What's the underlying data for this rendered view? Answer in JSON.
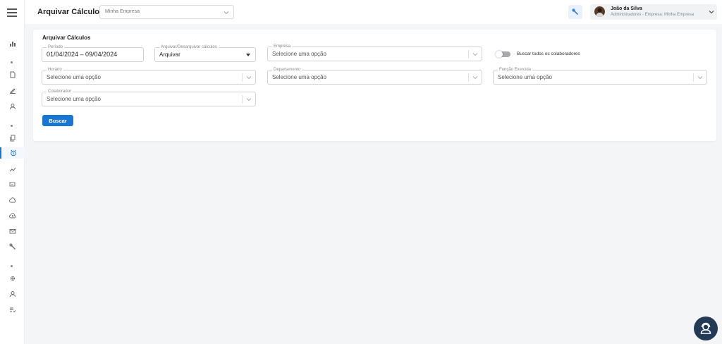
{
  "header": {
    "title": "Arquivar Cálculos",
    "company_select": "Minha Empresa",
    "user": {
      "name": "João da Silva",
      "role": "Administradores - Empresa: Minha Empresa"
    }
  },
  "sidebar": {
    "icons": [
      "chart-icon",
      "document-icon",
      "pen-icon",
      "user-icon",
      "copy-icon",
      "alarm-icon",
      "trend-icon",
      "chat-icon",
      "cloud-icon",
      "cloud-upload-icon",
      "mail-icon",
      "wrench-icon",
      "gear-icon",
      "person-icon",
      "checklist-icon"
    ],
    "active": "alarm-icon"
  },
  "form": {
    "title": "Arquivar Cálculos",
    "periodo": {
      "label": "Período",
      "value": "01/04/2024 – 09/04/2024"
    },
    "arquivar": {
      "label": "Arquivar/Desarquivar cálculos",
      "value": "Arquivar"
    },
    "empresa": {
      "label": "Empresa",
      "placeholder": "Selecione uma opção"
    },
    "toggle_label": "Buscar todos os colaboradores",
    "horario": {
      "label": "Horário",
      "placeholder": "Selecione uma opção"
    },
    "departamento": {
      "label": "Departamento",
      "placeholder": "Selecione uma opção"
    },
    "funcao": {
      "label": "Função Exercida",
      "placeholder": "Selecione uma opção"
    },
    "colaborador": {
      "label": "Colaborador",
      "placeholder": "Selecione uma opção"
    },
    "search_button": "Buscar"
  },
  "colors": {
    "accent": "#1976d2",
    "support": "#233a56"
  }
}
